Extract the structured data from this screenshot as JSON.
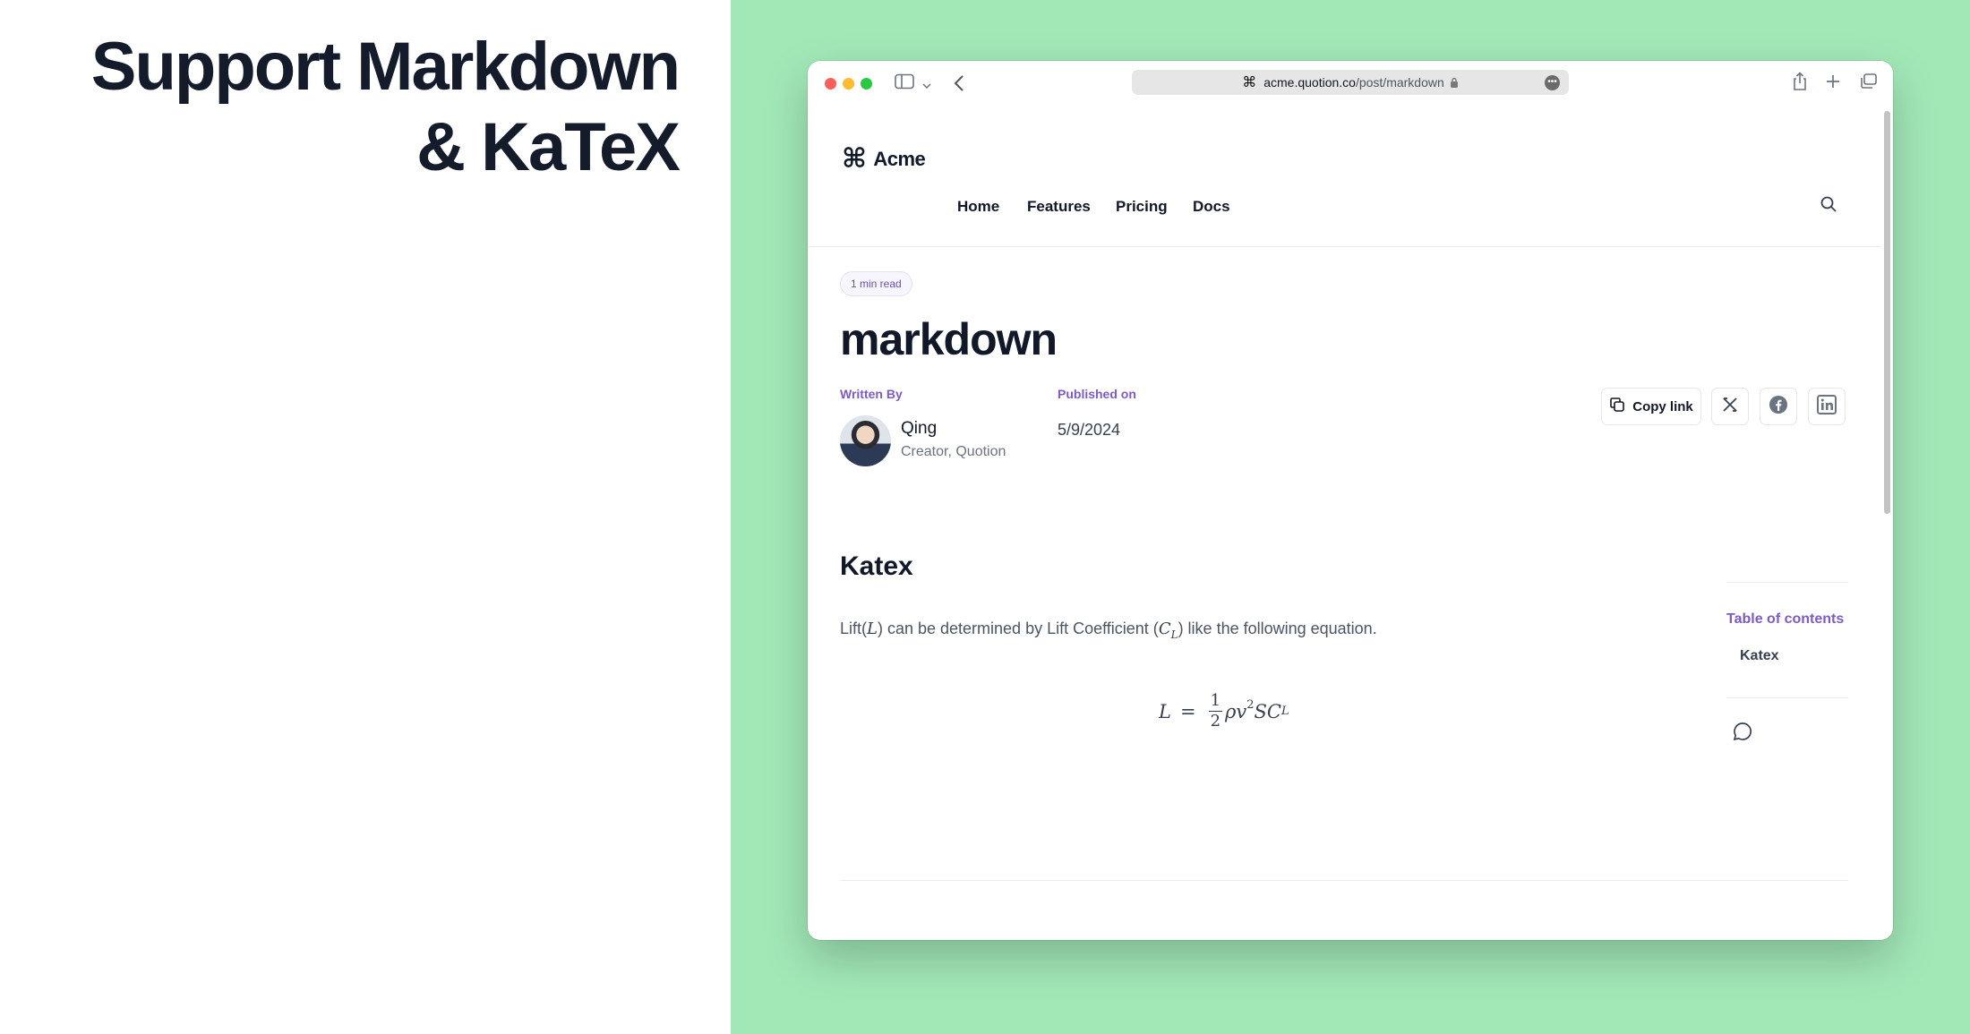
{
  "slide": {
    "headline_line1": "Support Markdown",
    "headline_line2": "& KaTeX"
  },
  "colors": {
    "background_green": "#a2e8b7",
    "accent_purple": "#7c5cc4",
    "text_dark": "#111827"
  },
  "browser": {
    "url_domain": "acme.quotion.co",
    "url_path": "/post/markdown",
    "icons": [
      "sidebar-icon",
      "chevron-down-icon",
      "back-icon",
      "lock-icon",
      "more-icon",
      "share-icon",
      "plus-icon",
      "tabs-icon"
    ]
  },
  "site": {
    "logo_text": "Acme",
    "logo_glyph": "⌘",
    "nav": [
      "Home",
      "Features",
      "Pricing",
      "Docs"
    ]
  },
  "post": {
    "read_time": "1 min read",
    "title": "markdown",
    "written_by_label": "Written By",
    "published_on_label": "Published on",
    "author_name": "Qing",
    "author_role": "Creator, Quotion",
    "published_date": "5/9/2024",
    "copy_link_label": "Copy link",
    "share_icons": [
      "x-icon",
      "facebook-icon",
      "linkedin-icon"
    ]
  },
  "content": {
    "section_heading": "Katex",
    "para_prefix": "Lift(",
    "para_var_L": "L",
    "para_middle": ") can be determined by Lift Coefficient (",
    "para_var_C": "C",
    "para_sub_L": "L",
    "para_suffix": ") like the following equation.",
    "equation_lhs": "L",
    "equation_eq": "=",
    "equation_num": "1",
    "equation_den": "2",
    "equation_rest": "ρv",
    "equation_pow": "2",
    "equation_tail": "SC",
    "equation_sub": "L"
  },
  "toc": {
    "title": "Table of contents",
    "items": [
      "Katex"
    ]
  }
}
